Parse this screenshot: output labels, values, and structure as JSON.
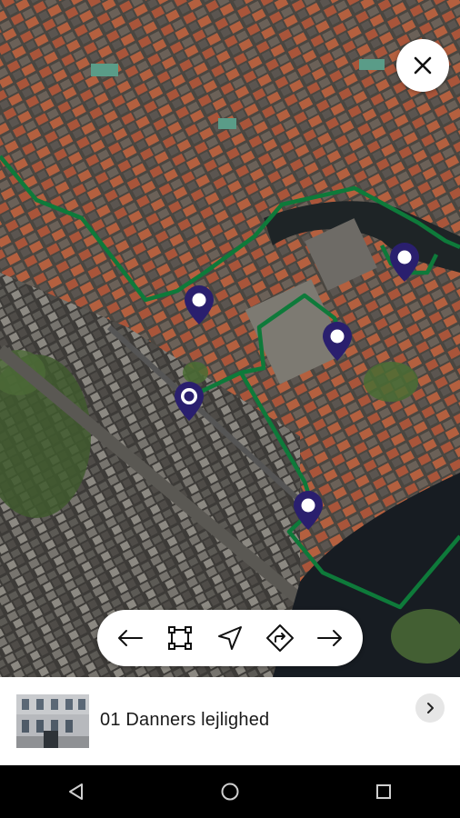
{
  "map": {
    "description_icon": "satellite-map",
    "route_color": "#0e7a3a",
    "pin_color": "#2a1f6e",
    "pins": [
      {
        "id": "pin-1",
        "icon": "location-pin-icon"
      },
      {
        "id": "pin-2",
        "icon": "location-pin-icon"
      },
      {
        "id": "pin-3",
        "icon": "location-pin-icon"
      },
      {
        "id": "pin-4",
        "icon": "location-pin-icon"
      },
      {
        "id": "current",
        "icon": "current-location-pin-icon"
      }
    ]
  },
  "toolbar": {
    "buttons": [
      {
        "name": "previous-button",
        "icon": "arrow-left-icon"
      },
      {
        "name": "fit-bounds-button",
        "icon": "frame-icon"
      },
      {
        "name": "my-location-button",
        "icon": "navigation-arrow-icon"
      },
      {
        "name": "directions-button",
        "icon": "directions-icon"
      },
      {
        "name": "next-button",
        "icon": "arrow-right-icon"
      }
    ]
  },
  "card": {
    "title": "01 Danners lejlighed",
    "thumbnail_icon": "building-photo"
  },
  "close_icon": "close-icon",
  "android_nav": [
    "back-icon",
    "home-icon",
    "recents-icon"
  ]
}
